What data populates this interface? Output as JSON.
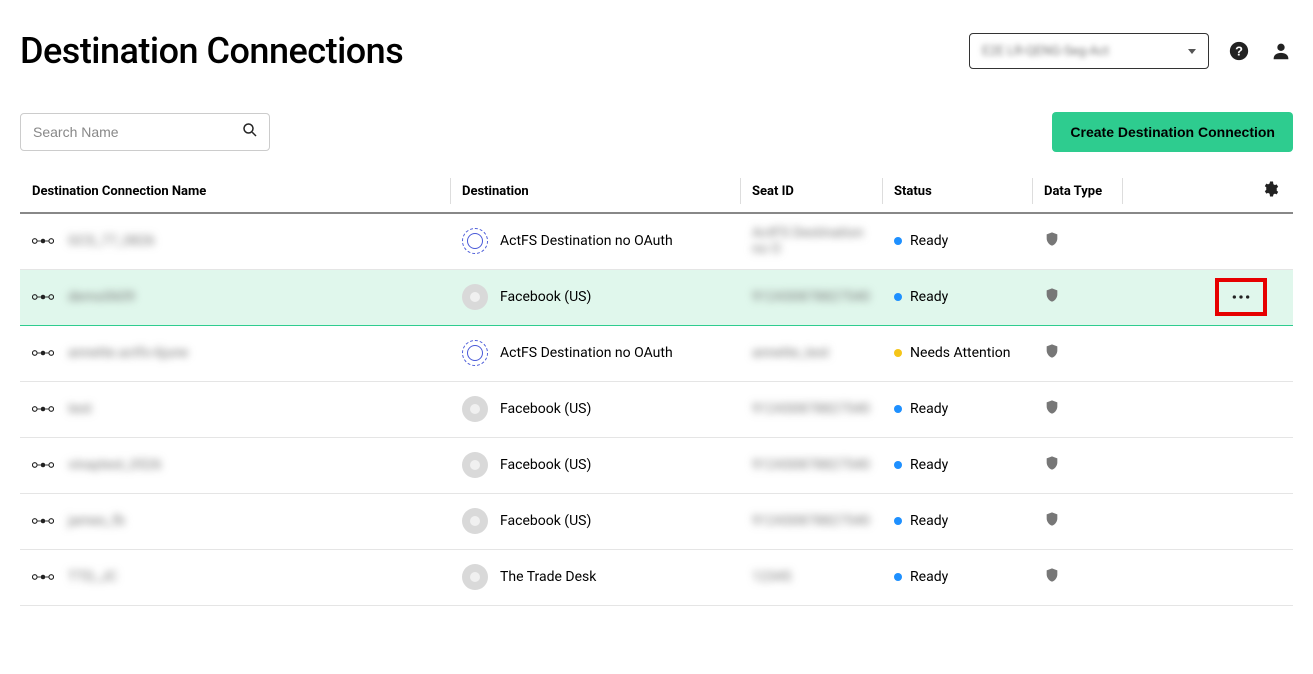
{
  "header": {
    "title": "Destination Connections",
    "account_label": "E2E LR-QENG-Seg-Act"
  },
  "toolbar": {
    "search_placeholder": "Search Name",
    "create_label": "Create Destination Connection"
  },
  "columns": {
    "name": "Destination Connection Name",
    "destination": "Destination",
    "seat": "Seat ID",
    "status": "Status",
    "datatype": "Data Type"
  },
  "statuses": {
    "ready": "Ready",
    "needs_attention": "Needs Attention"
  },
  "rows": [
    {
      "name_blur": "GCS_77_0826",
      "dest_icon": "actfs",
      "dest": "ActFS Destination no OAuth",
      "seat_blur": "ActFS Destination no O",
      "status": "ready",
      "highlighted": false
    },
    {
      "name_blur": "demo0609",
      "dest_icon": "gray",
      "dest": "Facebook (US)",
      "seat_blur": "912430878827540",
      "status": "ready",
      "highlighted": true
    },
    {
      "name_blur": "annette.actfs-6june",
      "dest_icon": "actfs",
      "dest": "ActFS Destination no OAuth",
      "seat_blur": "annette_test",
      "status": "needs_attention",
      "highlighted": false
    },
    {
      "name_blur": "test",
      "dest_icon": "gray",
      "dest": "Facebook (US)",
      "seat_blur": "912430878827540",
      "status": "ready",
      "highlighted": false
    },
    {
      "name_blur": "vinaytest_0526",
      "dest_icon": "gray",
      "dest": "Facebook (US)",
      "seat_blur": "912430878827540",
      "status": "ready",
      "highlighted": false
    },
    {
      "name_blur": "james_fb",
      "dest_icon": "gray",
      "dest": "Facebook (US)",
      "seat_blur": "912430878827540",
      "status": "ready",
      "highlighted": false
    },
    {
      "name_blur": "TTD_JC",
      "dest_icon": "gray",
      "dest": "The Trade Desk",
      "seat_blur": "12345",
      "status": "ready",
      "highlighted": false
    }
  ]
}
